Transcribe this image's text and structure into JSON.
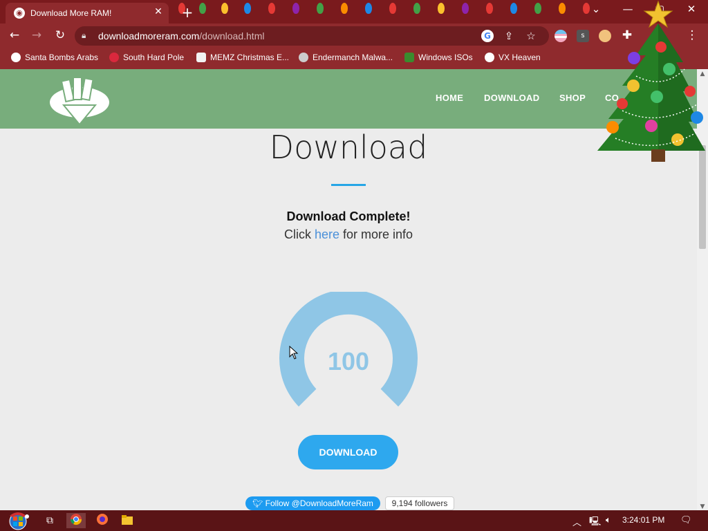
{
  "browser": {
    "tab_title": "Download More RAM!",
    "tab_close": "✕",
    "new_tab": "+",
    "url_host": "downloadmoreram.com",
    "url_path": "/download.html",
    "window_controls": [
      "⌄",
      "—",
      "▢",
      "✕"
    ]
  },
  "bookmarks": [
    {
      "label": "Santa Bombs Arabs",
      "icon": "santa-icon",
      "color": "#ffffff"
    },
    {
      "label": "South Hard Pole",
      "icon": "snowflake-icon",
      "color": "#d9283d"
    },
    {
      "label": "MEMZ Christmas E...",
      "icon": "memz-icon",
      "color": "#f2f2f2"
    },
    {
      "label": "Endermanch Malwa...",
      "icon": "endermanch-icon",
      "color": "#cccccc"
    },
    {
      "label": "Windows ISOs",
      "icon": "tree-icon",
      "color": "#3a8b2e"
    },
    {
      "label": "VX Heaven",
      "icon": "skull-icon",
      "color": "#ffffff"
    }
  ],
  "site": {
    "nav": [
      "HOME",
      "DOWNLOAD",
      "SHOP",
      "CO"
    ],
    "heading": "Download",
    "complete_text": "Download Complete!",
    "info_prefix": "Click ",
    "info_link": "here",
    "info_suffix": " for more info",
    "gauge_value": "100",
    "download_button": "DOWNLOAD",
    "twitter_follow": "Follow @DownloadMoreRam",
    "followers": "9,194 followers"
  },
  "taskbar": {
    "time": "3:24:01 PM"
  },
  "colors": {
    "header_green": "#78ad7c",
    "accent_blue": "#2ea8ee",
    "gauge_blue": "#8fc6e6",
    "browser_red": "#8f2a2d"
  }
}
